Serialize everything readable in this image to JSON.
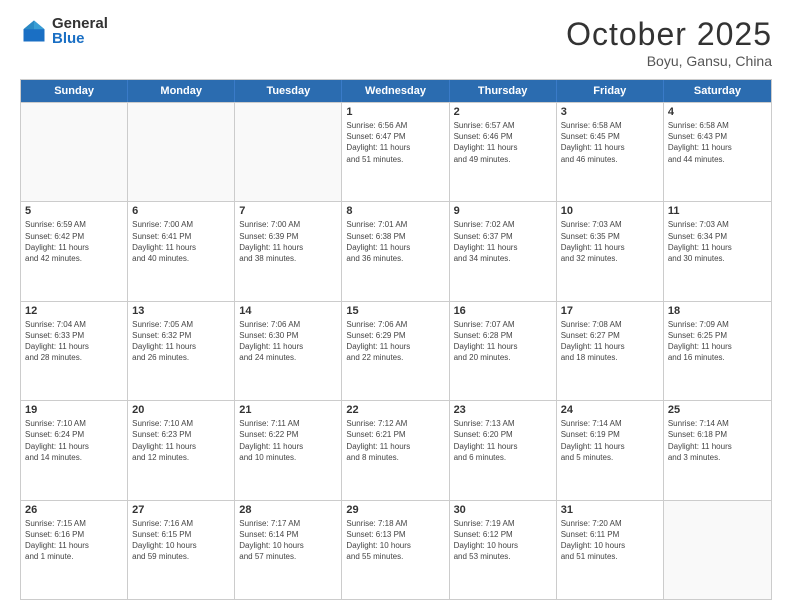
{
  "logo": {
    "general": "General",
    "blue": "Blue"
  },
  "header": {
    "month": "October 2025",
    "location": "Boyu, Gansu, China"
  },
  "weekdays": [
    "Sunday",
    "Monday",
    "Tuesday",
    "Wednesday",
    "Thursday",
    "Friday",
    "Saturday"
  ],
  "rows": [
    [
      {
        "day": "",
        "info": ""
      },
      {
        "day": "",
        "info": ""
      },
      {
        "day": "",
        "info": ""
      },
      {
        "day": "1",
        "info": "Sunrise: 6:56 AM\nSunset: 6:47 PM\nDaylight: 11 hours\nand 51 minutes."
      },
      {
        "day": "2",
        "info": "Sunrise: 6:57 AM\nSunset: 6:46 PM\nDaylight: 11 hours\nand 49 minutes."
      },
      {
        "day": "3",
        "info": "Sunrise: 6:58 AM\nSunset: 6:45 PM\nDaylight: 11 hours\nand 46 minutes."
      },
      {
        "day": "4",
        "info": "Sunrise: 6:58 AM\nSunset: 6:43 PM\nDaylight: 11 hours\nand 44 minutes."
      }
    ],
    [
      {
        "day": "5",
        "info": "Sunrise: 6:59 AM\nSunset: 6:42 PM\nDaylight: 11 hours\nand 42 minutes."
      },
      {
        "day": "6",
        "info": "Sunrise: 7:00 AM\nSunset: 6:41 PM\nDaylight: 11 hours\nand 40 minutes."
      },
      {
        "day": "7",
        "info": "Sunrise: 7:00 AM\nSunset: 6:39 PM\nDaylight: 11 hours\nand 38 minutes."
      },
      {
        "day": "8",
        "info": "Sunrise: 7:01 AM\nSunset: 6:38 PM\nDaylight: 11 hours\nand 36 minutes."
      },
      {
        "day": "9",
        "info": "Sunrise: 7:02 AM\nSunset: 6:37 PM\nDaylight: 11 hours\nand 34 minutes."
      },
      {
        "day": "10",
        "info": "Sunrise: 7:03 AM\nSunset: 6:35 PM\nDaylight: 11 hours\nand 32 minutes."
      },
      {
        "day": "11",
        "info": "Sunrise: 7:03 AM\nSunset: 6:34 PM\nDaylight: 11 hours\nand 30 minutes."
      }
    ],
    [
      {
        "day": "12",
        "info": "Sunrise: 7:04 AM\nSunset: 6:33 PM\nDaylight: 11 hours\nand 28 minutes."
      },
      {
        "day": "13",
        "info": "Sunrise: 7:05 AM\nSunset: 6:32 PM\nDaylight: 11 hours\nand 26 minutes."
      },
      {
        "day": "14",
        "info": "Sunrise: 7:06 AM\nSunset: 6:30 PM\nDaylight: 11 hours\nand 24 minutes."
      },
      {
        "day": "15",
        "info": "Sunrise: 7:06 AM\nSunset: 6:29 PM\nDaylight: 11 hours\nand 22 minutes."
      },
      {
        "day": "16",
        "info": "Sunrise: 7:07 AM\nSunset: 6:28 PM\nDaylight: 11 hours\nand 20 minutes."
      },
      {
        "day": "17",
        "info": "Sunrise: 7:08 AM\nSunset: 6:27 PM\nDaylight: 11 hours\nand 18 minutes."
      },
      {
        "day": "18",
        "info": "Sunrise: 7:09 AM\nSunset: 6:25 PM\nDaylight: 11 hours\nand 16 minutes."
      }
    ],
    [
      {
        "day": "19",
        "info": "Sunrise: 7:10 AM\nSunset: 6:24 PM\nDaylight: 11 hours\nand 14 minutes."
      },
      {
        "day": "20",
        "info": "Sunrise: 7:10 AM\nSunset: 6:23 PM\nDaylight: 11 hours\nand 12 minutes."
      },
      {
        "day": "21",
        "info": "Sunrise: 7:11 AM\nSunset: 6:22 PM\nDaylight: 11 hours\nand 10 minutes."
      },
      {
        "day": "22",
        "info": "Sunrise: 7:12 AM\nSunset: 6:21 PM\nDaylight: 11 hours\nand 8 minutes."
      },
      {
        "day": "23",
        "info": "Sunrise: 7:13 AM\nSunset: 6:20 PM\nDaylight: 11 hours\nand 6 minutes."
      },
      {
        "day": "24",
        "info": "Sunrise: 7:14 AM\nSunset: 6:19 PM\nDaylight: 11 hours\nand 5 minutes."
      },
      {
        "day": "25",
        "info": "Sunrise: 7:14 AM\nSunset: 6:18 PM\nDaylight: 11 hours\nand 3 minutes."
      }
    ],
    [
      {
        "day": "26",
        "info": "Sunrise: 7:15 AM\nSunset: 6:16 PM\nDaylight: 11 hours\nand 1 minute."
      },
      {
        "day": "27",
        "info": "Sunrise: 7:16 AM\nSunset: 6:15 PM\nDaylight: 10 hours\nand 59 minutes."
      },
      {
        "day": "28",
        "info": "Sunrise: 7:17 AM\nSunset: 6:14 PM\nDaylight: 10 hours\nand 57 minutes."
      },
      {
        "day": "29",
        "info": "Sunrise: 7:18 AM\nSunset: 6:13 PM\nDaylight: 10 hours\nand 55 minutes."
      },
      {
        "day": "30",
        "info": "Sunrise: 7:19 AM\nSunset: 6:12 PM\nDaylight: 10 hours\nand 53 minutes."
      },
      {
        "day": "31",
        "info": "Sunrise: 7:20 AM\nSunset: 6:11 PM\nDaylight: 10 hours\nand 51 minutes."
      },
      {
        "day": "",
        "info": ""
      }
    ]
  ]
}
